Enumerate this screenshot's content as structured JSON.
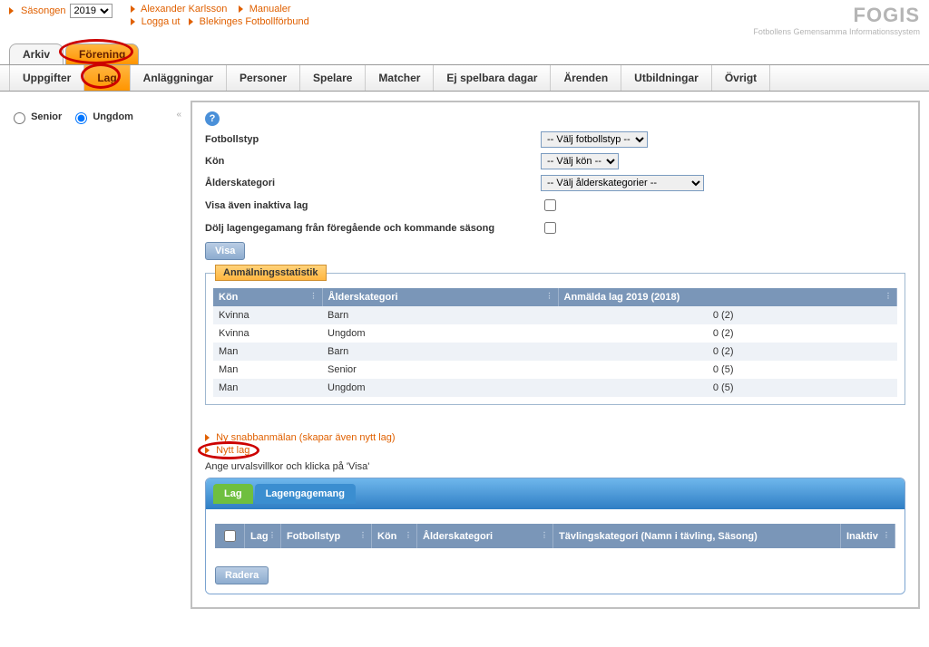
{
  "app": {
    "title": "FOGIS",
    "subtitle": "Fotbollens Gemensamma Informationssystem"
  },
  "season": {
    "label": "Säsongen",
    "value": "2019"
  },
  "breadcrumbs": {
    "row1": [
      "Alexander Karlsson",
      "Manualer"
    ],
    "row2": [
      "Logga ut",
      "Blekinges Fotbollförbund"
    ]
  },
  "main_tabs": {
    "arkiv": "Arkiv",
    "forening": "Förening"
  },
  "subnav": [
    "Uppgifter",
    "Lag",
    "Anläggningar",
    "Personer",
    "Spelare",
    "Matcher",
    "Ej spelbara dagar",
    "Ärenden",
    "Utbildningar",
    "Övrigt"
  ],
  "left": {
    "senior": "Senior",
    "ungdom": "Ungdom"
  },
  "form": {
    "fotbollstyp_label": "Fotbollstyp",
    "fotbollstyp_value": "-- Välj fotbollstyp --",
    "kon_label": "Kön",
    "kon_value": "-- Välj kön --",
    "alder_label": "Ålderskategori",
    "alder_value": "-- Välj ålderskategorier --",
    "visa_inaktiva": "Visa även inaktiva lag",
    "dolj_lagengagemang": "Dölj lagengegamang från föregående och kommande säsong",
    "visa_btn": "Visa"
  },
  "stats": {
    "legend": "Anmälningsstatistik",
    "headers": {
      "kon": "Kön",
      "alder": "Ålderskategori",
      "anmalda": "Anmälda lag 2019 (2018)"
    },
    "rows": [
      {
        "kon": "Kvinna",
        "alder": "Barn",
        "anmalda": "0 (2)"
      },
      {
        "kon": "Kvinna",
        "alder": "Ungdom",
        "anmalda": "0 (2)"
      },
      {
        "kon": "Man",
        "alder": "Barn",
        "anmalda": "0 (2)"
      },
      {
        "kon": "Man",
        "alder": "Senior",
        "anmalda": "0 (5)"
      },
      {
        "kon": "Man",
        "alder": "Ungdom",
        "anmalda": "0 (5)"
      }
    ]
  },
  "links": {
    "ny_snabb": "Ny snabbanmälan (skapar även nytt lag)",
    "nytt_lag": "Nytt lag"
  },
  "hint": "Ange urvalsvillkor och klicka på 'Visa'",
  "sub_tabs": {
    "lag": "Lag",
    "lagengagemang": "Lagengagemang"
  },
  "lag_table": {
    "headers": {
      "lag": "Lag",
      "fotbollstyp": "Fotbollstyp",
      "kon": "Kön",
      "alder": "Ålderskategori",
      "tavling": "Tävlingskategori (Namn i tävling, Säsong)",
      "inaktiv": "Inaktiv"
    }
  },
  "radera_btn": "Radera"
}
